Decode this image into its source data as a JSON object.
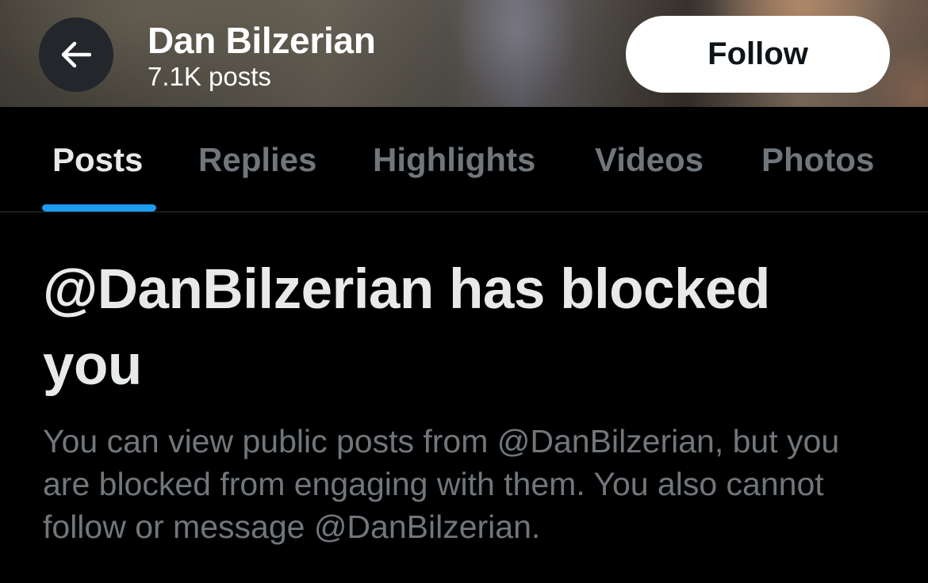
{
  "header": {
    "name": "Dan Bilzerian",
    "post_count": "7.1K posts",
    "back_icon": "arrow-left-icon",
    "follow_label": "Follow"
  },
  "tabs": [
    {
      "label": "Posts",
      "active": true
    },
    {
      "label": "Replies",
      "active": false
    },
    {
      "label": "Highlights",
      "active": false
    },
    {
      "label": "Videos",
      "active": false
    },
    {
      "label": "Photos",
      "active": false
    }
  ],
  "blocked": {
    "title": "@DanBilzerian has blocked you",
    "body": "You can view public posts from @DanBilzerian, but you are blocked from engaging with them. You also cannot follow or message @DanBilzerian."
  },
  "colors": {
    "background": "#000000",
    "accent": "#1d9bf0",
    "primary_text": "#e7e9ea",
    "secondary_text": "#71767b",
    "follow_button_bg": "#ffffff"
  }
}
